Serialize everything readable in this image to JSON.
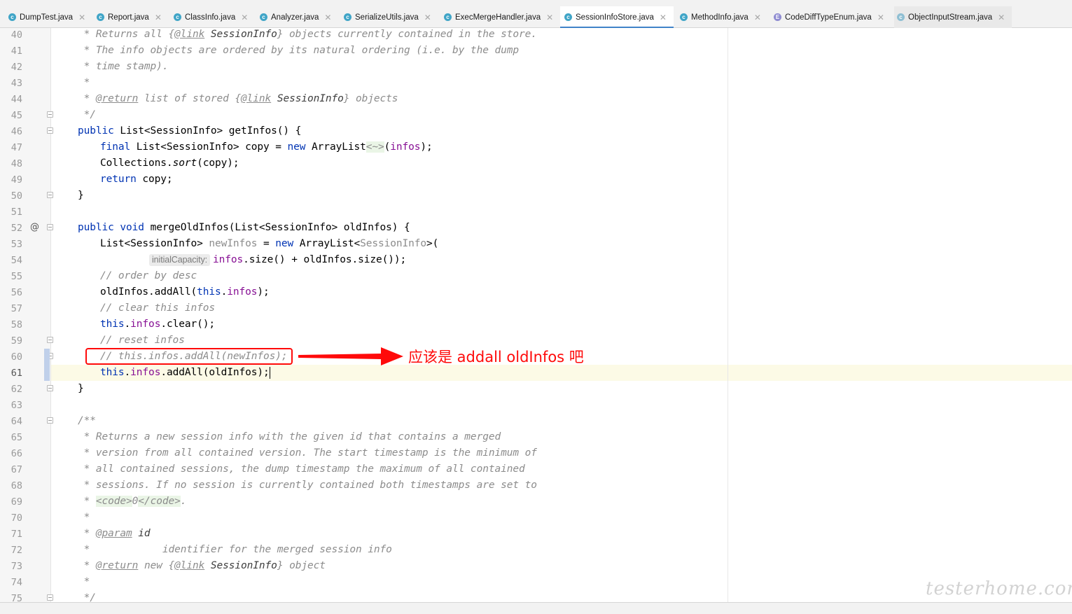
{
  "tabs": [
    {
      "label": "DumpTest.java",
      "icon": "class-icon"
    },
    {
      "label": "Report.java",
      "icon": "class-icon"
    },
    {
      "label": "ClassInfo.java",
      "icon": "class-icon"
    },
    {
      "label": "Analyzer.java",
      "icon": "class-icon"
    },
    {
      "label": "SerializeUtils.java",
      "icon": "class-icon"
    },
    {
      "label": "ExecMergeHandler.java",
      "icon": "class-icon"
    },
    {
      "label": "SessionInfoStore.java",
      "icon": "class-icon"
    },
    {
      "label": "MethodInfo.java",
      "icon": "class-icon"
    },
    {
      "label": "CodeDiffTypeEnum.java",
      "icon": "enum-icon"
    },
    {
      "label": "ObjectInputStream.java",
      "icon": "library-class-icon"
    }
  ],
  "active_tab": "SessionInfoStore.java",
  "line_numbers": [
    "40",
    "41",
    "42",
    "43",
    "44",
    "45",
    "46",
    "47",
    "48",
    "49",
    "50",
    "51",
    "52",
    "53",
    "54",
    "55",
    "56",
    "57",
    "58",
    "59",
    "60",
    "61",
    "62",
    "63",
    "64",
    "65",
    "66",
    "67",
    "68",
    "69",
    "70",
    "71",
    "72",
    "73",
    "74",
    "75"
  ],
  "current_line": "61",
  "annotation": {
    "callout": "应该是 addall oldInfos 吧"
  },
  "watermark": "testerhome.com",
  "code": {
    "l40": {
      "a": " * Returns all {",
      "b": "@link",
      "c": " SessionInfo",
      "d": "} objects currently contained in the store."
    },
    "l41": " * The info objects are ordered by its natural ordering (i.e. by the dump",
    "l42": " * time stamp).",
    "l43": " *",
    "l44": {
      "a": " * ",
      "b": "@return",
      "c": " list of stored {",
      "d": "@link",
      "e": " SessionInfo",
      "f": "} objects"
    },
    "l45": " */",
    "l46": {
      "a": "public",
      "b": " List<SessionInfo> getInfos() {"
    },
    "l47": {
      "a": "final",
      "b": " List<SessionInfo> copy = ",
      "c": "new",
      "d": " ArrayList",
      "e": "<~>",
      "f": "(",
      "g": "infos",
      "h": ");"
    },
    "l48": {
      "a": "Collections.",
      "b": "sort",
      "c": "(copy);"
    },
    "l49": {
      "a": "return",
      "b": " copy;"
    },
    "l50": "}",
    "l52": {
      "a": "public",
      "b": " ",
      "c": "void",
      "d": " mergeOldInfos(List<SessionInfo> oldInfos) {"
    },
    "l53": {
      "a": "List<SessionInfo> ",
      "b": "newInfos",
      "c": " = ",
      "d": "new",
      "e": " ArrayList<",
      "f": "SessionInfo",
      "g": ">("
    },
    "l54": {
      "hint": "initialCapacity:",
      "a": "infos",
      "b": ".size() + oldInfos.size());"
    },
    "l55": "// order by desc",
    "l56": {
      "a": "oldInfos.addAll(",
      "b": "this",
      "c": ".",
      "d": "infos",
      "e": ");"
    },
    "l57": "// clear this infos",
    "l58": {
      "a": "this",
      "b": ".",
      "c": "infos",
      "d": ".clear();"
    },
    "l59": "// reset infos",
    "l60": "// this.infos.addAll(newInfos);",
    "l61": {
      "a": "this",
      "b": ".",
      "c": "infos",
      "d": ".addAll(oldInfos);"
    },
    "l62": "}",
    "l64": "/**",
    "l65": " * Returns a new session info with the given id that contains a merged",
    "l66": " * version from all contained version. The start timestamp is the minimum of",
    "l67": " * all contained sessions, the dump timestamp the maximum of all contained",
    "l68": " * sessions. If no session is currently contained both timestamps are set to",
    "l69": {
      "a": " * ",
      "b": "<code>",
      "c": "0",
      "d": "</code>",
      "e": "."
    },
    "l70": " *",
    "l71": {
      "a": " * ",
      "b": "@param",
      "c": " id"
    },
    "l72": " *            identifier for the merged session info",
    "l73": {
      "a": " * ",
      "b": "@return",
      "c": " new {",
      "d": "@link",
      "e": " SessionInfo",
      "f": "} object"
    },
    "l74": " *",
    "l75": " */"
  }
}
